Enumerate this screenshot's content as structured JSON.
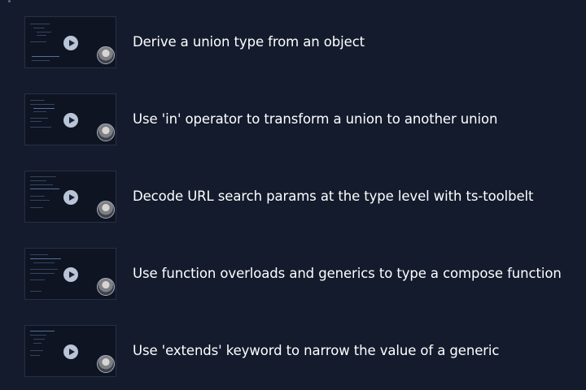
{
  "lessons": [
    {
      "title": "Derive a union type from an object",
      "play_icon": "play-icon",
      "avatar": "instructor-avatar"
    },
    {
      "title": "Use 'in' operator to transform a union to another union",
      "play_icon": "play-icon",
      "avatar": "instructor-avatar"
    },
    {
      "title": "Decode URL search params at the type level with ts-toolbelt",
      "play_icon": "play-icon",
      "avatar": "instructor-avatar"
    },
    {
      "title": "Use function overloads and generics to type a compose function",
      "play_icon": "play-icon",
      "avatar": "instructor-avatar"
    },
    {
      "title": "Use 'extends' keyword to narrow the value of a generic",
      "play_icon": "play-icon",
      "avatar": "instructor-avatar"
    }
  ],
  "colors": {
    "background": "#131b2d",
    "text": "#ffffff",
    "play_button": "#b9c4d6"
  }
}
